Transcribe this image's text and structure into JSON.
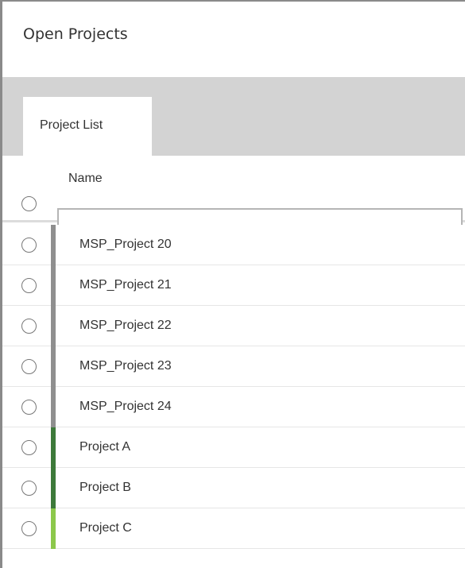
{
  "dialog": {
    "title": "Open Projects"
  },
  "tabs": [
    {
      "label": "Project List",
      "active": true
    }
  ],
  "table": {
    "column_name": "Name",
    "filter": {
      "value": "",
      "placeholder": ""
    },
    "rows": [
      {
        "name": "MSP_Project 20",
        "bar_color": "#8f8f8f"
      },
      {
        "name": "MSP_Project 21",
        "bar_color": "#8f8f8f"
      },
      {
        "name": "MSP_Project 22",
        "bar_color": "#8f8f8f"
      },
      {
        "name": "MSP_Project 23",
        "bar_color": "#8f8f8f"
      },
      {
        "name": "MSP_Project 24",
        "bar_color": "#8f8f8f"
      },
      {
        "name": "Project A",
        "bar_color": "#3d7a3a"
      },
      {
        "name": "Project B",
        "bar_color": "#3d7a3a"
      },
      {
        "name": "Project C",
        "bar_color": "#8cc84b"
      }
    ]
  }
}
